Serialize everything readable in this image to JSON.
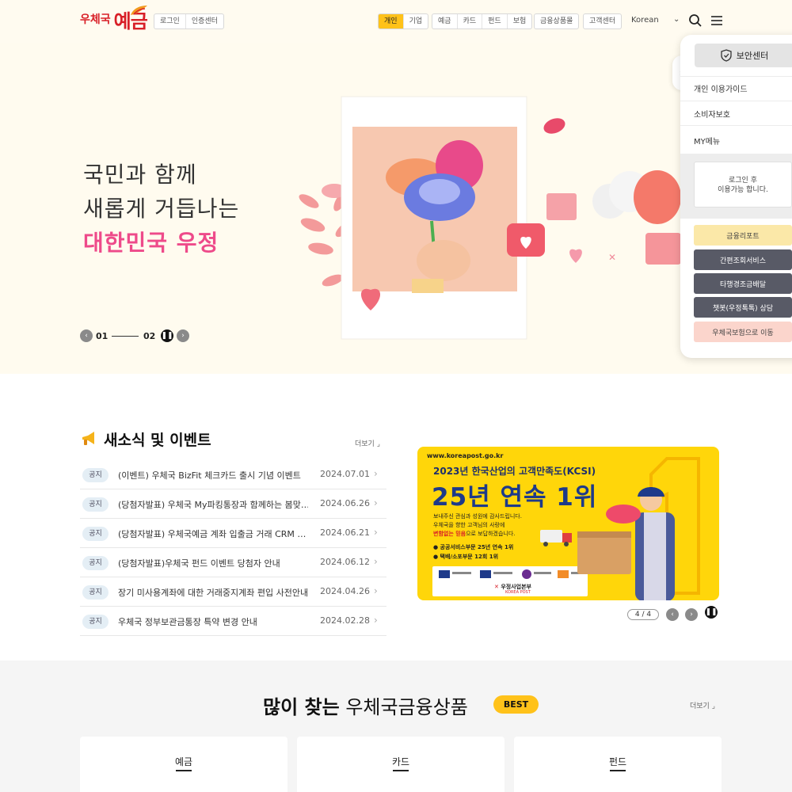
{
  "header": {
    "logo_small": "우체국",
    "logo_big": "예금",
    "auth_buttons": [
      "로그인",
      "인증센터"
    ],
    "segment_buttons": [
      "개인",
      "기업"
    ],
    "product_buttons": [
      "예금",
      "카드",
      "펀드",
      "보험"
    ],
    "mall_button": "금융상품몰",
    "customer_button": "고객센터",
    "language": "Korean"
  },
  "hero": {
    "line1": "국민과 함께",
    "line2": "새롭게 거듭나는",
    "line3": "대한민국 우정",
    "slide_current": "01",
    "slide_total": "02"
  },
  "side_panel": {
    "security_center": "보안센터",
    "menu": [
      "개인 이용가이드",
      "소비자보호",
      "MY메뉴"
    ],
    "login_notice_line1": "로그인 후",
    "login_notice_line2": "이용가능 합니다.",
    "buttons": [
      "금융리포트",
      "간편조회서비스",
      "타행경조금배달",
      "챗봇(우정톡톡) 상담",
      "우체국보험으로 이동"
    ]
  },
  "news": {
    "title": "새소식 및 이벤트",
    "more": "더보기",
    "items": [
      {
        "badge": "공지",
        "text": "(이벤트) 우체국 BizFit 체크카드 출시 기념 이벤트",
        "date": "2024.07.01"
      },
      {
        "badge": "공지",
        "text": "(당첨자발표) 우체국 My파킹통장과 함께하는 봄맞…",
        "date": "2024.06.26"
      },
      {
        "badge": "공지",
        "text": "(당첨자발표) 우체국예금 계좌 입출금 거래 CRM …",
        "date": "2024.06.21"
      },
      {
        "badge": "공지",
        "text": "(당첨자발표)우체국 펀드 이벤트 당첨자 안내",
        "date": "2024.06.12"
      },
      {
        "badge": "공지",
        "text": "장기 미사용계좌에 대한 거래중지계좌 편입 사전안내",
        "date": "2024.04.26"
      },
      {
        "badge": "공지",
        "text": "우체국 정부보관금통장 특약 변경 안내",
        "date": "2024.02.28"
      }
    ]
  },
  "banner": {
    "url": "www.koreapost.go.kr",
    "headline": "2023년 한국산업의 고객만족도(KCSI)",
    "big_text": "25년 연속 1위",
    "body_line1": "보내주신 관심과 성원에 감사드립니다.",
    "body_line2": "우체국을 향한 고객님의 사랑에",
    "body_line3_emph": "변함없는 믿음",
    "body_line3_rest": "으로 보답하겠습니다.",
    "bullet1": "● 공공서비스부문 25년 연속 1위",
    "bullet2": "● 택배/소포부문 12회 1위",
    "org": "우정사업본부",
    "org_en": "KOREA POST",
    "counter": "4 / 4"
  },
  "best": {
    "title_bold": "많이 찾는",
    "title_rest": " 우체국금융상품",
    "badge": "BEST",
    "more": "더보기",
    "cards": [
      "예금",
      "카드",
      "펀드"
    ]
  },
  "colors": {
    "accent_yellow": "#ffc21a",
    "brand_red": "#d81f27",
    "hero_pink": "#ee4a8a",
    "dark_button": "#585a66"
  }
}
